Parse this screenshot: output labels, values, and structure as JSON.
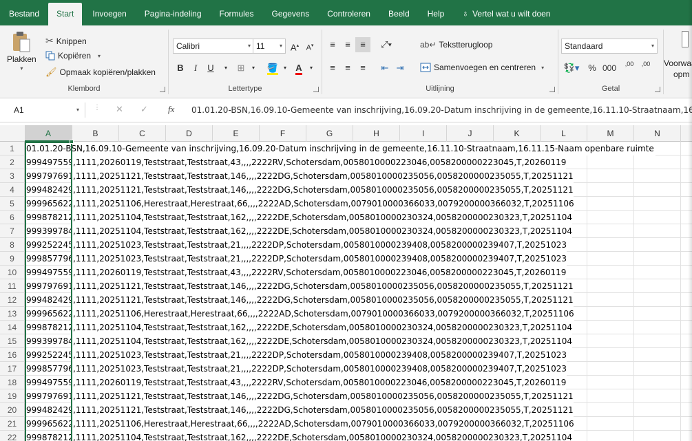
{
  "tabs": [
    {
      "label": "Bestand",
      "active": false
    },
    {
      "label": "Start",
      "active": true
    },
    {
      "label": "Invoegen",
      "active": false
    },
    {
      "label": "Pagina-indeling",
      "active": false
    },
    {
      "label": "Formules",
      "active": false
    },
    {
      "label": "Gegevens",
      "active": false
    },
    {
      "label": "Controleren",
      "active": false
    },
    {
      "label": "Beeld",
      "active": false
    },
    {
      "label": "Help",
      "active": false
    }
  ],
  "tell_me": {
    "label": "Vertel wat u wilt doen",
    "icon": "lightbulb-icon"
  },
  "ribbon": {
    "clipboard": {
      "paste": "Plakken",
      "cut": "Knippen",
      "copy": "Kopiëren",
      "format_painter": "Opmaak kopiëren/plakken",
      "group_label": "Klembord"
    },
    "font": {
      "family": "Calibri",
      "size": "11",
      "bold": "B",
      "italic": "I",
      "underline": "U",
      "grow": "A",
      "shrink": "A",
      "group_label": "Lettertype"
    },
    "alignment": {
      "wrap_text": "Tekstterugloop",
      "merge": "Samenvoegen en centreren",
      "group_label": "Uitlijning"
    },
    "number": {
      "format": "Standaard",
      "percent": "%",
      "thousands": "000",
      "inc_decimal": ",00",
      "dec_decimal": ",00",
      "group_label": "Getal"
    },
    "styles": {
      "conditional": "Voorwaa",
      "conditional_2": "opm"
    }
  },
  "formula_bar": {
    "name_box": "A1",
    "fx": "fx",
    "content": "01.01.20-BSN,16.09.10-Gemeente van inschrijving,16.09.20-Datum inschrijving in de gemeente,16.11.10-Straatnaam,16.11.15-Naam openbare ruimte"
  },
  "columns": [
    "A",
    "B",
    "C",
    "D",
    "E",
    "F",
    "G",
    "H",
    "I",
    "J",
    "K",
    "L",
    "M",
    "N"
  ],
  "selected_column": "A",
  "rows": [
    {
      "n": "1",
      "a": "01.01.20-BSN,16.09.10-Gemeente van inschrijving,16.09.20-Datum inschrijving in de gemeente,16.11.10-Straatnaam,16.11.15-Naam openbare ruimte",
      "rest": ""
    },
    {
      "n": "2",
      "a": "999497559",
      "rest": ",1111,20260119,Teststraat,Teststraat,43,,,,2222RV,Schotersdam,0058010000223046,0058200000223045,T,20260119"
    },
    {
      "n": "3",
      "a": "999797691",
      "rest": ",1111,20251121,Teststraat,Teststraat,146,,,,2222DG,Schotersdam,0058010000235056,0058200000235055,T,20251121"
    },
    {
      "n": "4",
      "a": "999482429",
      "rest": ",1111,20251121,Teststraat,Teststraat,146,,,,2222DG,Schotersdam,0058010000235056,0058200000235055,T,20251121"
    },
    {
      "n": "5",
      "a": "999965622",
      "rest": ",1111,20251106,Herestraat,Herestraat,66,,,,2222AD,Schotersdam,0079010000366033,0079200000366032,T,20251106"
    },
    {
      "n": "6",
      "a": "999878212",
      "rest": ",1111,20251104,Teststraat,Teststraat,162,,,,2222DE,Schotersdam,0058010000230324,0058200000230323,T,20251104"
    },
    {
      "n": "7",
      "a": "999399784",
      "rest": ",1111,20251104,Teststraat,Teststraat,162,,,,2222DE,Schotersdam,0058010000230324,0058200000230323,T,20251104"
    },
    {
      "n": "8",
      "a": "999252245",
      "rest": ",1111,20251023,Teststraat,Teststraat,21,,,,2222DP,Schotersdam,0058010000239408,0058200000239407,T,20251023"
    },
    {
      "n": "9",
      "a": "999857796",
      "rest": ",1111,20251023,Teststraat,Teststraat,21,,,,2222DP,Schotersdam,0058010000239408,0058200000239407,T,20251023"
    },
    {
      "n": "10",
      "a": "999497559",
      "rest": ",1111,20260119,Teststraat,Teststraat,43,,,,2222RV,Schotersdam,0058010000223046,0058200000223045,T,20260119"
    },
    {
      "n": "11",
      "a": "999797691",
      "rest": ",1111,20251121,Teststraat,Teststraat,146,,,,2222DG,Schotersdam,0058010000235056,0058200000235055,T,20251121"
    },
    {
      "n": "12",
      "a": "999482429",
      "rest": ",1111,20251121,Teststraat,Teststraat,146,,,,2222DG,Schotersdam,0058010000235056,0058200000235055,T,20251121"
    },
    {
      "n": "13",
      "a": "999965622",
      "rest": ",1111,20251106,Herestraat,Herestraat,66,,,,2222AD,Schotersdam,0079010000366033,0079200000366032,T,20251106"
    },
    {
      "n": "14",
      "a": "999878212",
      "rest": ",1111,20251104,Teststraat,Teststraat,162,,,,2222DE,Schotersdam,0058010000230324,0058200000230323,T,20251104"
    },
    {
      "n": "15",
      "a": "999399784",
      "rest": ",1111,20251104,Teststraat,Teststraat,162,,,,2222DE,Schotersdam,0058010000230324,0058200000230323,T,20251104"
    },
    {
      "n": "16",
      "a": "999252245",
      "rest": ",1111,20251023,Teststraat,Teststraat,21,,,,2222DP,Schotersdam,0058010000239408,0058200000239407,T,20251023"
    },
    {
      "n": "17",
      "a": "999857796",
      "rest": ",1111,20251023,Teststraat,Teststraat,21,,,,2222DP,Schotersdam,0058010000239408,0058200000239407,T,20251023"
    },
    {
      "n": "18",
      "a": "999497559",
      "rest": ",1111,20260119,Teststraat,Teststraat,43,,,,2222RV,Schotersdam,0058010000223046,0058200000223045,T,20260119"
    },
    {
      "n": "19",
      "a": "999797691",
      "rest": ",1111,20251121,Teststraat,Teststraat,146,,,,2222DG,Schotersdam,0058010000235056,0058200000235055,T,20251121"
    },
    {
      "n": "20",
      "a": "999482429",
      "rest": ",1111,20251121,Teststraat,Teststraat,146,,,,2222DG,Schotersdam,0058010000235056,0058200000235055,T,20251121"
    },
    {
      "n": "21",
      "a": "999965622",
      "rest": ",1111,20251106,Herestraat,Herestraat,66,,,,2222AD,Schotersdam,0079010000366033,0079200000366032,T,20251106"
    },
    {
      "n": "22",
      "a": "999878212",
      "rest": ",1111,20251104,Teststraat,Teststraat,162,,,,2222DE,Schotersdam,0058010000230324,0058200000230323,T,20251104"
    }
  ],
  "colors": {
    "accent": "#217346",
    "ribbon_bg": "#f3f3f3",
    "grid_line": "#e1e1e1"
  }
}
